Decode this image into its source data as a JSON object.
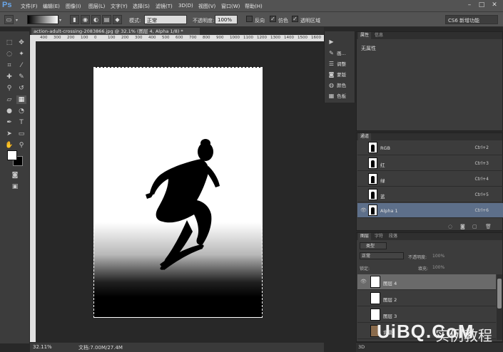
{
  "app": {
    "logo": "Ps"
  },
  "menu": [
    "文件(F)",
    "编辑(E)",
    "图像(I)",
    "图层(L)",
    "文字(Y)",
    "选择(S)",
    "滤镜(T)",
    "3D(D)",
    "视图(V)",
    "窗口(W)",
    "帮助(H)"
  ],
  "window_controls": {
    "minimize": "–",
    "maximize": "□",
    "close": "✕"
  },
  "options": {
    "mode_label": "模式:",
    "mode_value": "正常",
    "opacity_label": "不透明度:",
    "opacity_value": "100%",
    "reverse_label": "反向",
    "dither_label": "仿色",
    "transparency_label": "透明区域",
    "workspace": "CS6 新增功能"
  },
  "document": {
    "tab_title": "action-adult-crossing-2083866.jpg @ 32.1% (图层 4, Alpha 1/8) *",
    "ruler_ticks": [
      "400",
      "300",
      "200",
      "100",
      "0",
      "100",
      "200",
      "300",
      "400",
      "500",
      "600",
      "700",
      "800",
      "900",
      "1000",
      "1100",
      "1200",
      "1300",
      "1400",
      "1500",
      "1600"
    ]
  },
  "status": {
    "zoom": "32.11%",
    "doc": "文档:7.00M/27.4M"
  },
  "dock": {
    "items": [
      {
        "label": "",
        "icon": "play-icon"
      },
      {
        "label": "画...",
        "icon": "brush-icon"
      },
      {
        "label": "调整",
        "icon": "sliders-icon"
      },
      {
        "label": "蒙版",
        "icon": "mask-icon"
      },
      {
        "label": "颜色",
        "icon": "palette-icon"
      },
      {
        "label": "色板",
        "icon": "swatches-icon"
      }
    ]
  },
  "properties": {
    "tabs": [
      "属性",
      "信息"
    ],
    "content": "无属性"
  },
  "channels": {
    "tab": "通道",
    "rows": [
      {
        "name": "RGB",
        "shortcut": "Ctrl+2"
      },
      {
        "name": "红",
        "shortcut": "Ctrl+3"
      },
      {
        "name": "绿",
        "shortcut": "Ctrl+4"
      },
      {
        "name": "蓝",
        "shortcut": "Ctrl+5"
      },
      {
        "name": "Alpha 1",
        "shortcut": "Ctrl+6"
      }
    ]
  },
  "layers": {
    "tabs": [
      "图层",
      "字符",
      "段落"
    ],
    "filter": "类型",
    "blend": "正常",
    "opacity_label": "不透明度:",
    "opacity_value": "100%",
    "lock_label": "锁定:",
    "fill_label": "填充:",
    "fill_value": "100%",
    "rows": [
      {
        "name": "图层 4"
      },
      {
        "name": "图层 2"
      },
      {
        "name": "图层 3"
      },
      {
        "name": "背景"
      }
    ]
  },
  "bottom_tab": "3D",
  "watermark": {
    "brand": "UiBQ.CoM",
    "sub": "实例教程"
  }
}
